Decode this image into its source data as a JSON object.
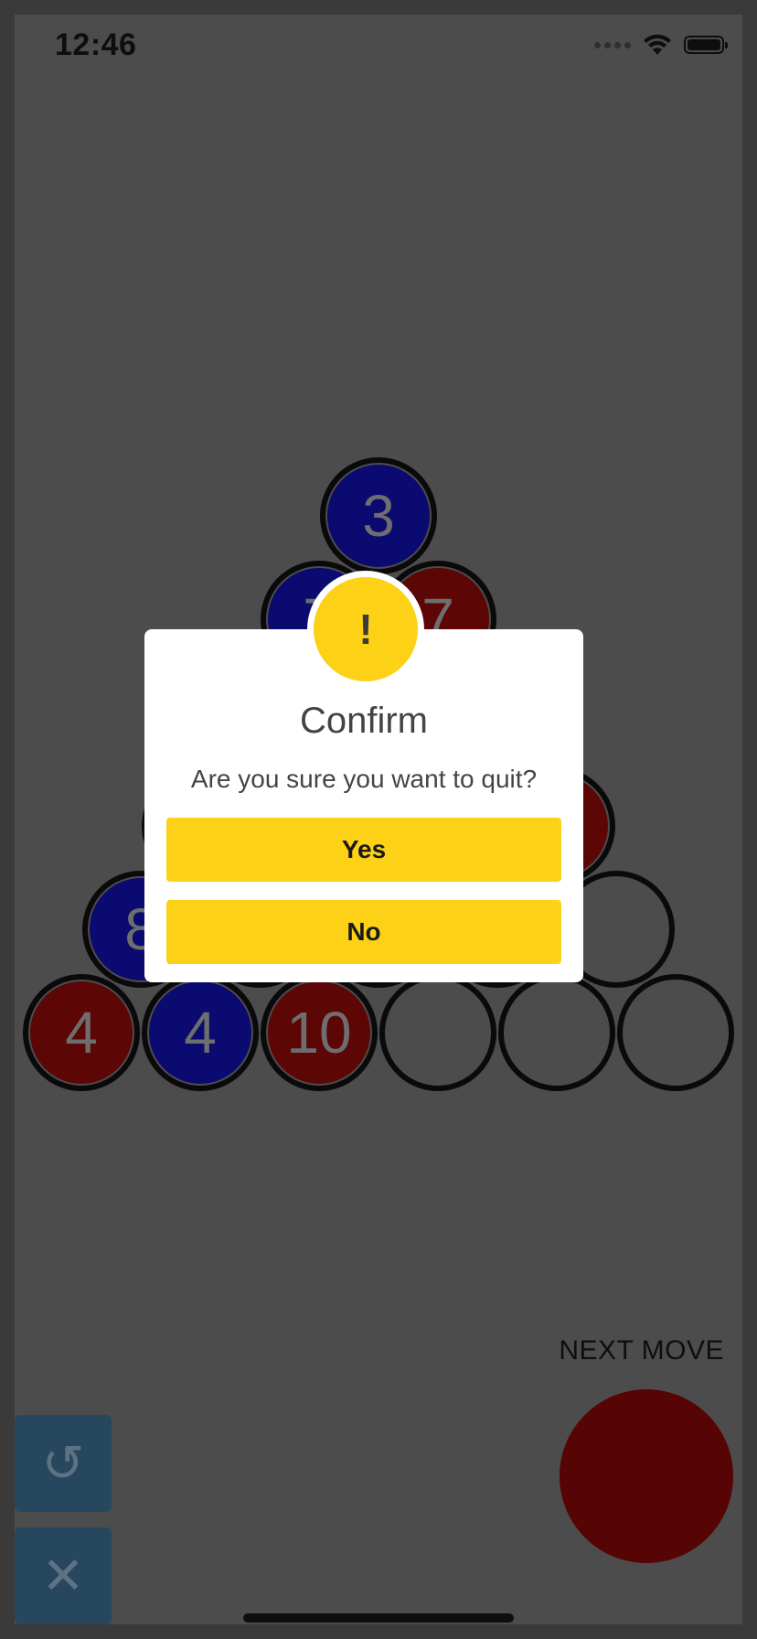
{
  "status_bar": {
    "time": "12:46"
  },
  "board": {
    "rows": [
      [
        {
          "color": "blue",
          "value": "3"
        }
      ],
      [
        {
          "color": "blue",
          "value": "7"
        },
        {
          "color": "red",
          "value": "7"
        }
      ],
      [
        {
          "color": "red",
          "value": ""
        },
        {
          "color": "empty",
          "value": ""
        },
        {
          "color": "empty",
          "value": ""
        }
      ],
      [
        {
          "color": "red",
          "value": ""
        },
        {
          "color": "empty",
          "value": ""
        },
        {
          "color": "empty",
          "value": ""
        },
        {
          "color": "red",
          "value": ""
        }
      ],
      [
        {
          "color": "blue",
          "value": "8"
        },
        {
          "color": "red",
          "value": ""
        },
        {
          "color": "blue",
          "value": ""
        },
        {
          "color": "empty",
          "value": ""
        },
        {
          "color": "empty",
          "value": ""
        }
      ],
      [
        {
          "color": "red",
          "value": "4"
        },
        {
          "color": "blue",
          "value": "4"
        },
        {
          "color": "red",
          "value": "10"
        },
        {
          "color": "empty",
          "value": ""
        },
        {
          "color": "empty",
          "value": ""
        },
        {
          "color": "empty",
          "value": ""
        }
      ]
    ]
  },
  "next_move": {
    "label": "NEXT MOVE",
    "color": "#560404"
  },
  "controls": {
    "undo_icon": "↺",
    "quit_icon": "✕"
  },
  "dialog": {
    "icon": "!",
    "title": "Confirm",
    "message": "Are you sure you want to quit?",
    "yes_label": "Yes",
    "no_label": "No"
  },
  "colors": {
    "accent": "#fcd116",
    "blue_ball": "#0a0a70",
    "red_ball": "#5c0606",
    "overlay_bg": "#4c4c4c",
    "side_button": "#27475e"
  }
}
